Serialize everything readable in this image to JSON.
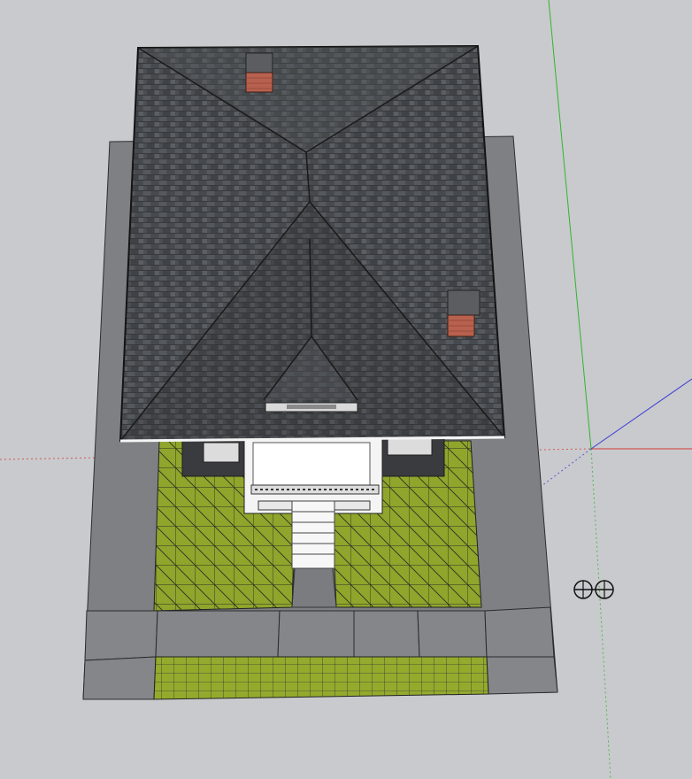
{
  "viewport": {
    "background": "#c9cacd",
    "icon": "model-viewport"
  },
  "axes": {
    "red": "#d23b3b",
    "green": "#2fb52f",
    "blue": "#3a3ad6"
  },
  "model": {
    "roof_color": "#4b4e52",
    "chimney_color": "#b8614e",
    "lawn_color": "#8fa52c",
    "sidewalk_color": "#7e8084",
    "porch_color": "#f4f4f4"
  },
  "cursor": {
    "icon": "orbit-cursor-icon"
  }
}
